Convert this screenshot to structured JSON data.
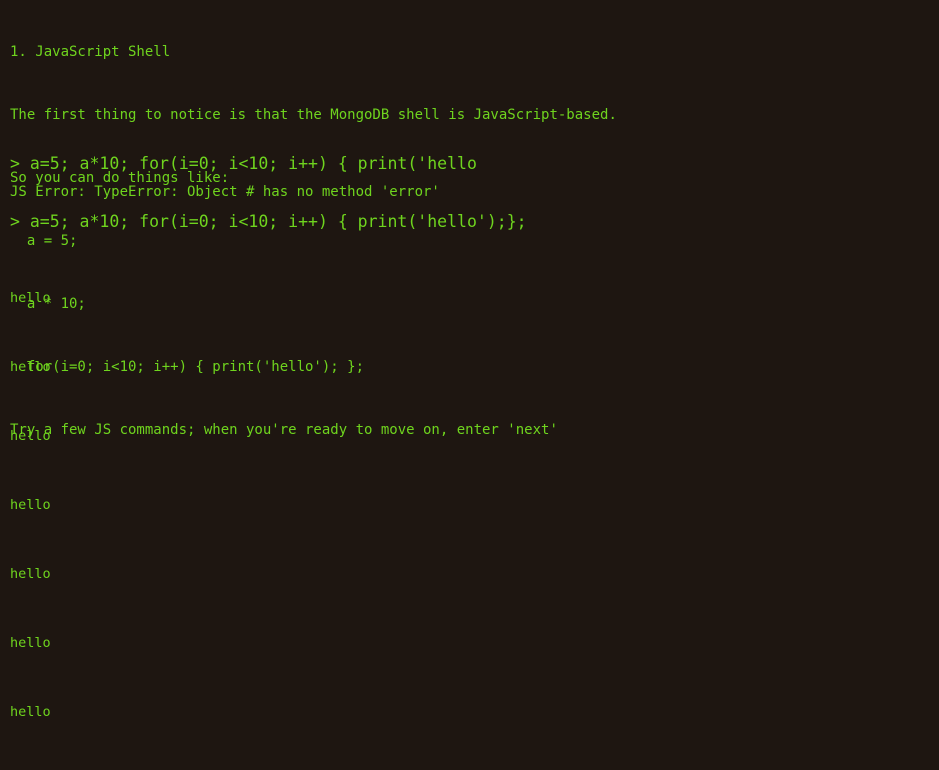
{
  "intro": [
    "1. JavaScript Shell",
    "The first thing to notice is that the MongoDB shell is JavaScript-based.",
    "So you can do things like:",
    "  a = 5;",
    "  a * 10;",
    "  for(i=0; i<10; i++) { print('hello'); };",
    "Try a few JS commands; when you're ready to move on, enter 'next'"
  ],
  "history": {
    "prompt1": "> a=5; a*10; for(i=0; i<10; i++) { print('hello",
    "error": "JS Error: TypeError: Object # has no method 'error'",
    "prompt2": "> a=5; a*10; for(i=0; i<10; i++) { print('hello');};",
    "output": [
      "hello",
      "hello",
      "hello",
      "hello",
      "hello",
      "hello",
      "hello"
    ]
  },
  "colors": {
    "background": "#1e1611",
    "text": "#6fd41e"
  }
}
